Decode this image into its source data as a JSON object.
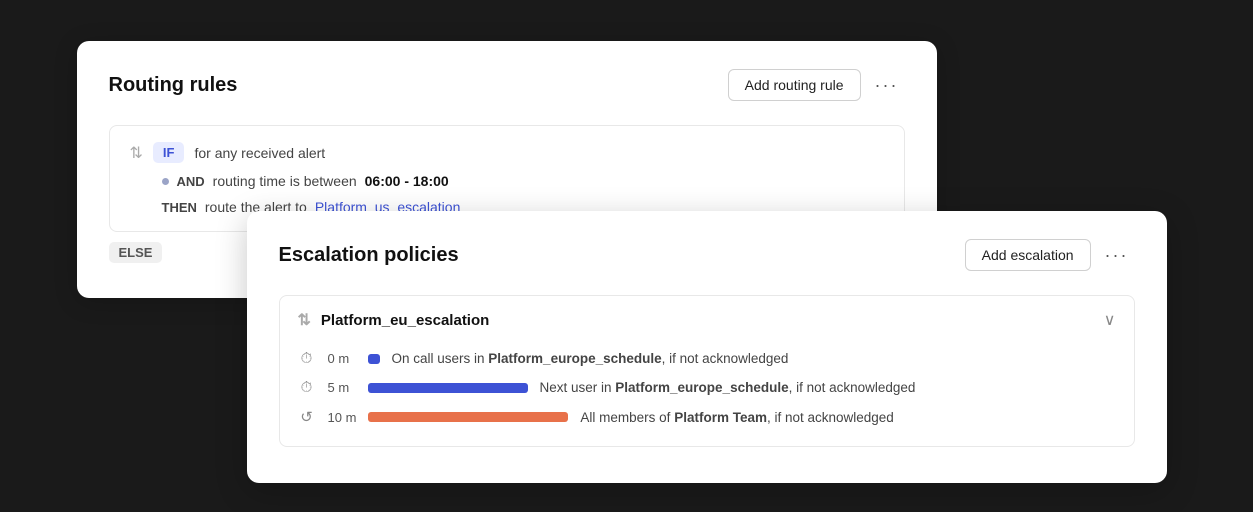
{
  "routing": {
    "title": "Routing rules",
    "add_button_label": "Add routing rule",
    "more_icon": "···",
    "rule": {
      "if_label": "IF",
      "if_text": "for any received alert",
      "and_label": "AND",
      "and_text": "routing time is between",
      "time_range": "06:00 - 18:00",
      "then_label": "THEN",
      "then_text": "route the alert to",
      "then_target": "Platform_us_escalation",
      "else_label": "ELSE"
    }
  },
  "escalation": {
    "title": "Escalation policies",
    "add_button_label": "Add escalation",
    "more_icon": "···",
    "policy": {
      "name": "Platform_eu_escalation",
      "steps": [
        {
          "time": "0 m",
          "bar_class": "bar-short",
          "description_prefix": "On call users in",
          "schedule": "Platform_europe_schedule",
          "description_suffix": ", if not acknowledged"
        },
        {
          "time": "5 m",
          "bar_class": "bar-medium",
          "description_prefix": "Next user in",
          "schedule": "Platform_europe_schedule",
          "description_suffix": ", if not acknowledged"
        },
        {
          "time": "10 m",
          "bar_class": "bar-long",
          "description_prefix": "All members of",
          "schedule": "Platform Team",
          "description_suffix": ", if not acknowledged"
        }
      ]
    }
  }
}
